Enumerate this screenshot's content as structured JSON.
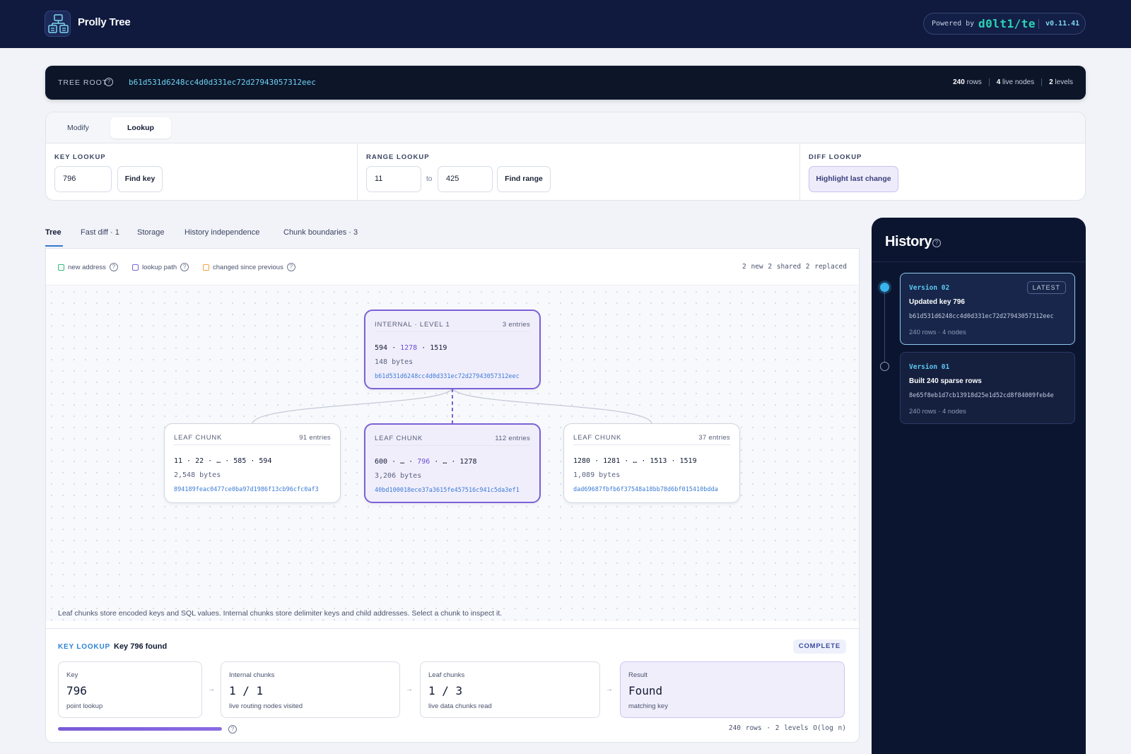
{
  "app": {
    "title": "Prolly Tree",
    "powered_label": "Powered by",
    "brand": "d0lt1/te",
    "version": "v0.11.41"
  },
  "tree_root": {
    "label": "TREE ROOT",
    "hash": "b61d531d6248cc4d0d331ec72d27943057312eec",
    "rows_value": "240",
    "rows_label": "rows",
    "nodes_value": "4",
    "nodes_label": "live nodes",
    "levels_value": "2",
    "levels_label": "levels"
  },
  "ops": {
    "tabs": [
      "Modify",
      "Lookup"
    ],
    "active_tab": "Lookup",
    "key_lookup": {
      "label": "KEY LOOKUP",
      "value": "796",
      "button": "Find key"
    },
    "range_lookup": {
      "label": "RANGE LOOKUP",
      "from": "11",
      "to_label": "to",
      "to": "425",
      "button": "Find range"
    },
    "diff_lookup": {
      "label": "DIFF LOOKUP",
      "button": "Highlight last change"
    }
  },
  "view_tabs": [
    "Tree",
    "Fast diff · 1",
    "Storage",
    "History independence",
    "Chunk boundaries · 3"
  ],
  "legend": {
    "items": [
      {
        "label": "new address",
        "color": "#2fb37a"
      },
      {
        "label": "lookup path",
        "color": "#7b61d6"
      },
      {
        "label": "changed since previous",
        "color": "#f0a040"
      }
    ],
    "counts": "2 new  2 shared  2 replaced"
  },
  "tree": {
    "internal": {
      "title": "INTERNAL · LEVEL 1",
      "entries": "3 entries",
      "keys": {
        "a": "594",
        "sep1": " · ",
        "hl": "1278",
        "sep2": " · ",
        "b": "1519"
      },
      "bytes": "148 bytes",
      "address": "b61d531d6248cc4d0d331ec72d27943057312eec"
    },
    "leaves": [
      {
        "title": "LEAF CHUNK",
        "entries": "91 entries",
        "keys_pre": "11 · 22 · … · 585 · 594",
        "keys_hl": "",
        "keys_post": "",
        "bytes": "2,548 bytes",
        "address": "894189feac0477ce0ba97d1986f13cb96cfc0af3"
      },
      {
        "title": "LEAF CHUNK",
        "entries": "112 entries",
        "keys_pre": "600 · … · ",
        "keys_hl": "796",
        "keys_post": " · … · 1278",
        "bytes": "3,206 bytes",
        "address": "40bd100018ece37a3615fe457516c941c5da3ef1"
      },
      {
        "title": "LEAF CHUNK",
        "entries": "37 entries",
        "keys_pre": "1280 · 1281 · … · 1513 · 1519",
        "keys_hl": "",
        "keys_post": "",
        "bytes": "1,089 bytes",
        "address": "dad69687fbfb6f37548a18bb78d6bf015410bdda"
      }
    ],
    "caption": "Leaf chunks store encoded keys and SQL values. Internal chunks store delimiter keys and child addresses. Select a chunk to inspect it."
  },
  "result": {
    "label": "KEY LOOKUP",
    "summary": "Key 796 found",
    "status": "COMPLETE",
    "cards": [
      {
        "title": "Key",
        "value": "796",
        "sub": "point lookup"
      },
      {
        "title": "Internal chunks",
        "value": "1 / 1",
        "sub": "live routing nodes visited"
      },
      {
        "title": "Leaf chunks",
        "value": "1 / 3",
        "sub": "live data chunks read"
      },
      {
        "title": "Result",
        "value": "Found",
        "sub": "matching key"
      }
    ],
    "arrow": "→",
    "progress": 1.0,
    "meta": "240 rows · 2 levels  O(log n)"
  },
  "history": {
    "title": "History",
    "versions": [
      {
        "name": "Version 02",
        "badge": "LATEST",
        "desc": "Updated key 796",
        "hash": "b61d531d6248cc4d0d331ec72d27943057312eec",
        "meta": "240 rows · 4 nodes"
      },
      {
        "name": "Version 01",
        "badge": "",
        "desc": "Built 240 sparse rows",
        "hash": "8e65f8eb1d7cb13918d25e1d52cd8f84009feb4e",
        "meta": "240 rows · 4 nodes"
      }
    ]
  }
}
